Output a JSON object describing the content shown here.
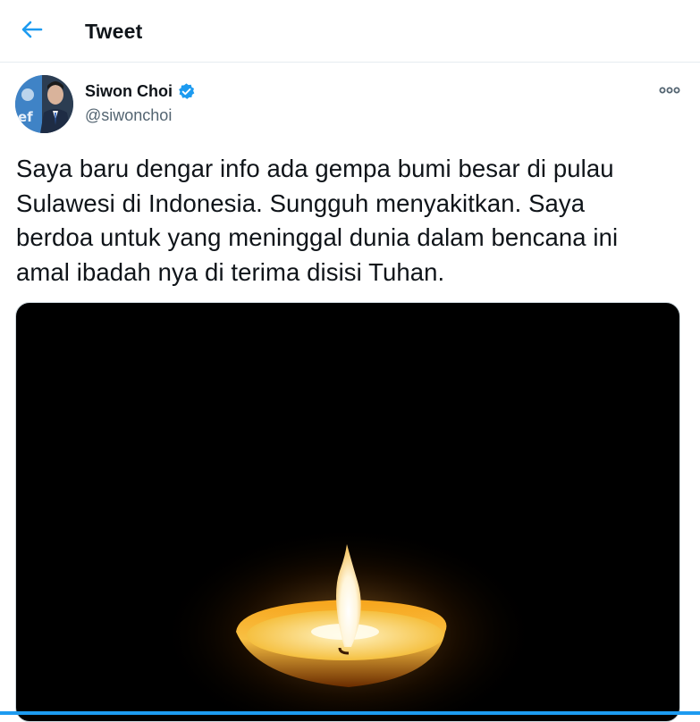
{
  "header": {
    "title": "Tweet",
    "back_icon": "arrow-left-icon"
  },
  "tweet": {
    "author": {
      "name": "Siwon Choi",
      "handle": "@siwonchoi",
      "verified": true,
      "verified_icon": "verified-badge-icon"
    },
    "more_icon": "more-horizontal-icon",
    "text_lines": [
      "Saya baru dengar info ada gempa bumi besar di pulau",
      "Sulawesi di Indonesia. Sungguh menyakitkan. Saya",
      "berdoa untuk yang meninggal dunia dalam bencana ini",
      "amal ibadah nya di terima disisi Tuhan."
    ],
    "media": {
      "subject": "lit candle in darkness"
    }
  },
  "colors": {
    "accent": "#1d9bf0",
    "text": "#0f1419",
    "secondary_text": "#536471",
    "divider": "#e6ecf0"
  }
}
